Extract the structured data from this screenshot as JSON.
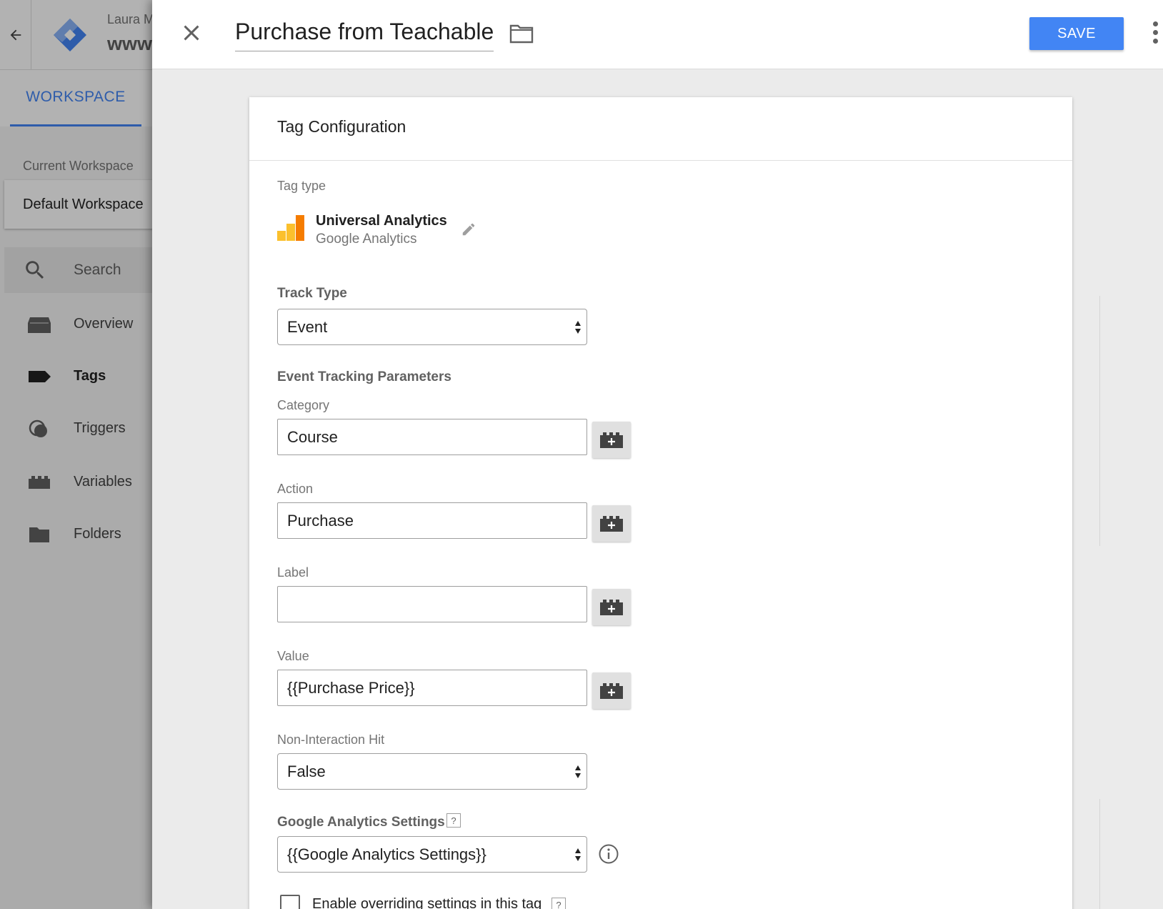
{
  "background_app": {
    "account": "Laura M",
    "container": "www",
    "tab_workspace": "WORKSPACE",
    "current_workspace_label": "Current Workspace",
    "workspace_name": "Default Workspace",
    "search_label": "Search",
    "nav": [
      {
        "label": "Overview",
        "icon": "overview-icon",
        "active": false
      },
      {
        "label": "Tags",
        "icon": "tag-icon",
        "active": true
      },
      {
        "label": "Triggers",
        "icon": "trigger-icon",
        "active": false
      },
      {
        "label": "Variables",
        "icon": "variable-icon",
        "active": false
      },
      {
        "label": "Folders",
        "icon": "folder-icon",
        "active": false
      }
    ]
  },
  "editor": {
    "tag_name": "Purchase from Teachable",
    "save_label": "SAVE",
    "card_title": "Tag Configuration",
    "tag_type_label": "Tag type",
    "tag_type_name": "Universal Analytics",
    "tag_type_sub": "Google Analytics",
    "track_type_label": "Track Type",
    "track_type_value": "Event",
    "event_params_label": "Event Tracking Parameters",
    "category_label": "Category",
    "category_value": "Course",
    "action_label": "Action",
    "action_value": "Purchase",
    "label_label": "Label",
    "label_value": "",
    "value_label": "Value",
    "value_value": "{{Purchase Price}}",
    "non_interaction_label": "Non-Interaction Hit",
    "non_interaction_value": "False",
    "ga_settings_label": "Google Analytics Settings",
    "ga_settings_value": "{{Google Analytics Settings}}",
    "help_glyph": "?",
    "override_label": "Enable overriding settings in this tag",
    "override_checked": false
  },
  "colors": {
    "accent": "#4285f4",
    "ga_orange": "#f57c00",
    "ga_yellow": "#fbc02d"
  }
}
